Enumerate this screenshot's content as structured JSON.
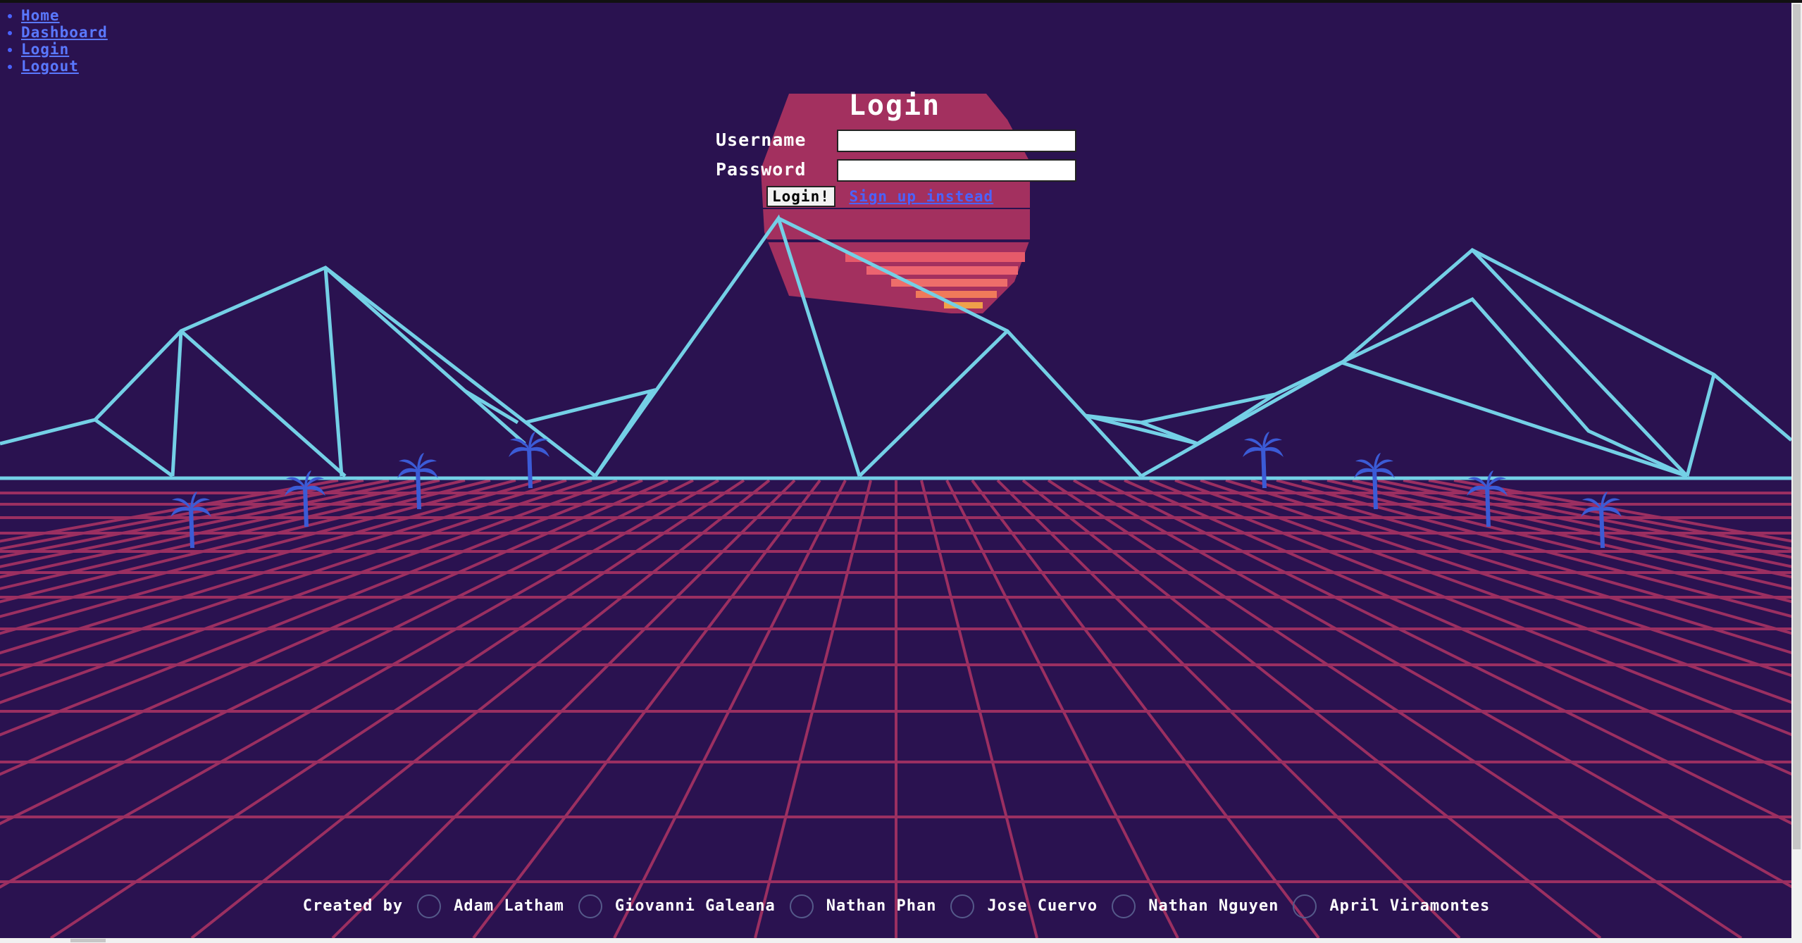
{
  "nav": {
    "items": [
      {
        "label": "Home"
      },
      {
        "label": "Dashboard"
      },
      {
        "label": "Login"
      },
      {
        "label": "Logout"
      }
    ]
  },
  "login": {
    "title": "Login",
    "username_label": "Username",
    "password_label": "Password",
    "username_value": "",
    "password_value": "",
    "submit_label": "Login!",
    "signup_link": "Sign up instead"
  },
  "footer": {
    "prefix": "Created by",
    "creators": [
      {
        "name": "Adam Latham"
      },
      {
        "name": "Giovanni Galeana"
      },
      {
        "name": "Nathan Phan"
      },
      {
        "name": "Jose Cuervo"
      },
      {
        "name": "Nathan Nguyen"
      },
      {
        "name": "April Viramontes"
      }
    ]
  },
  "colors": {
    "background": "#2a1250",
    "grid": "#9b2f61",
    "mountains": "#74d0e6",
    "palms": "#3b5bd6",
    "sun_top": "#a3305f",
    "sun_bottom": "#f0a04a",
    "link": "#4a63ff"
  }
}
